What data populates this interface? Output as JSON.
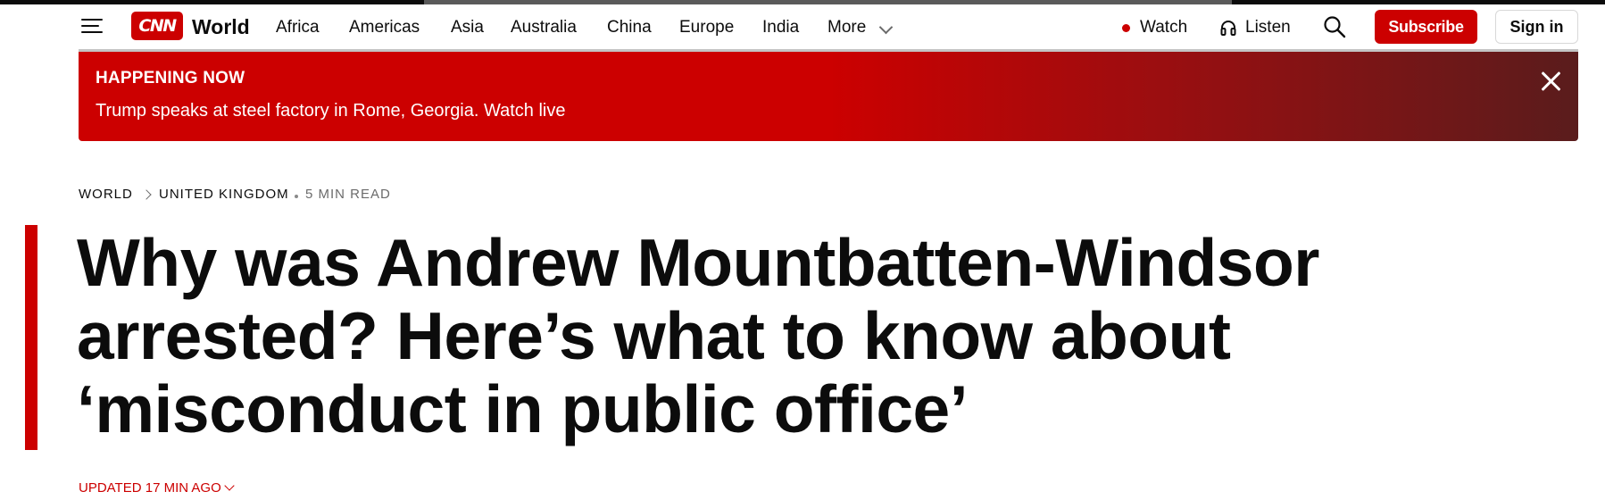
{
  "header": {
    "logo_text": "CNN",
    "section_name": "World",
    "nav": [
      "Africa",
      "Americas",
      "Asia",
      "Australia",
      "China",
      "Europe",
      "India",
      "More"
    ],
    "watch_label": "Watch",
    "listen_label": "Listen",
    "subscribe_label": "Subscribe",
    "signin_label": "Sign in",
    "icons": {
      "menu": "hamburger-icon",
      "more": "chevron-down-icon",
      "watch": "live-dot-icon",
      "listen": "headphones-icon",
      "search": "search-icon"
    }
  },
  "banner": {
    "kicker": "HAPPENING NOW",
    "headline": "Trump speaks at steel factory in Rome, Georgia. Watch live",
    "close_icon": "close-icon"
  },
  "breadcrumbs": {
    "items": [
      "WORLD",
      "UNITED KINGDOM"
    ],
    "read_time": "5 MIN READ"
  },
  "article": {
    "headline": "Why was Andrew Mountbatten-Windsor arrested? Here’s what to know about ‘misconduct in public office’",
    "updated": "UPDATED 17 MIN AGO"
  },
  "colors": {
    "brand_red": "#cc0000",
    "text": "#0c0c0c",
    "muted": "#6b6b6b"
  }
}
